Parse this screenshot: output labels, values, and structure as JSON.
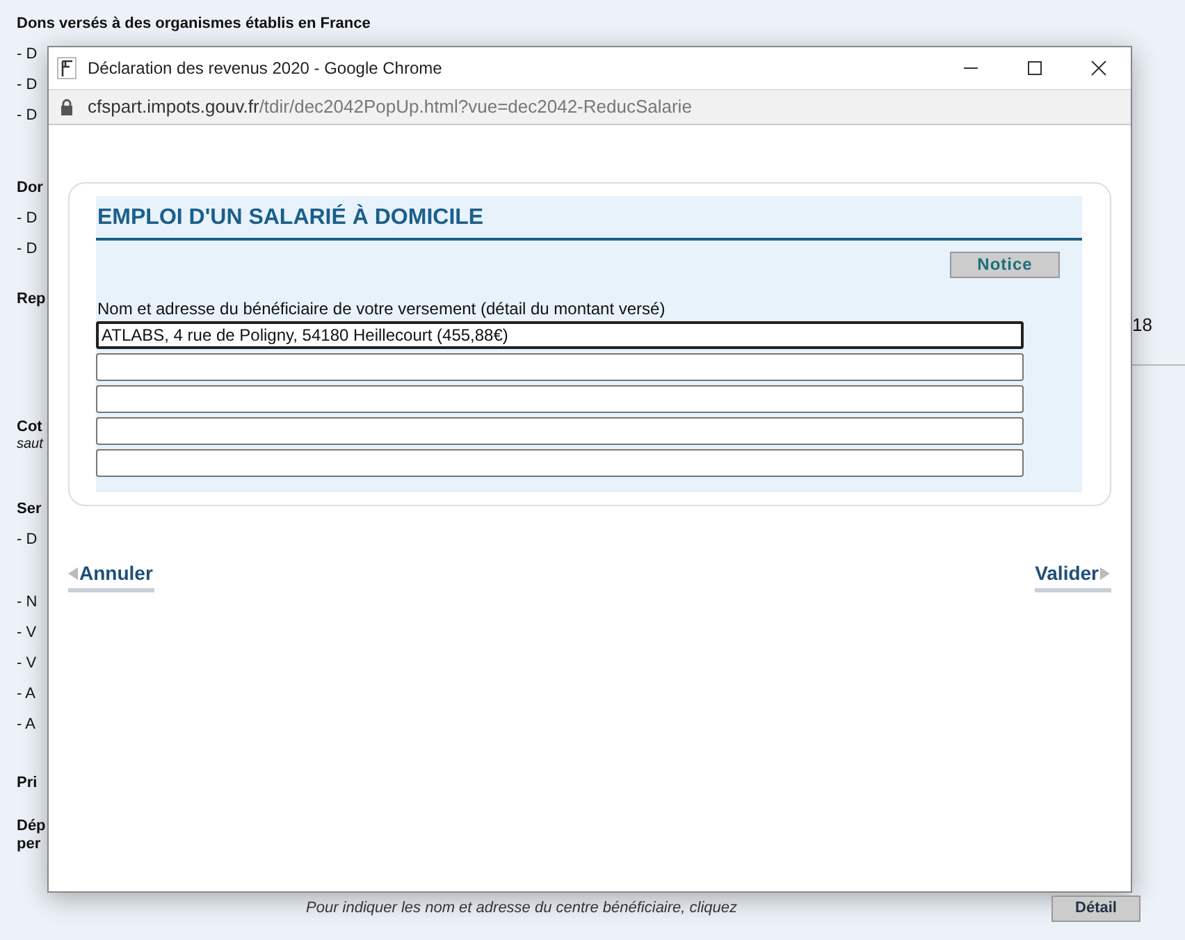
{
  "background_page": {
    "sections": [
      {
        "heading": "Dons versés à des organismes établis en France",
        "lines": [
          "- D",
          "- D",
          "- D"
        ]
      },
      {
        "heading": "Dor",
        "lines": [
          "- D",
          "- D"
        ]
      },
      {
        "heading": "Rep"
      },
      {
        "heading": "Cot",
        "note": "saut"
      },
      {
        "heading": "Ser",
        "lines": [
          "- D"
        ]
      },
      {
        "lines": [
          "- N",
          "- V",
          "- V",
          "- A",
          "- A"
        ]
      },
      {
        "heading": "Pri"
      },
      {
        "heading": "Dép",
        "heading_line_2": "per"
      }
    ],
    "right_value": "18",
    "bottom_note": "Pour indiquer les nom et adresse du centre bénéficiaire, cliquez",
    "bottom_button": "Détail"
  },
  "window": {
    "title": "Déclaration des revenus 2020 - Google Chrome",
    "url_host": "cfspart.impots.gouv.fr",
    "url_path": "/tdir/dec2042PopUp.html?vue=dec2042-ReducSalarie"
  },
  "form": {
    "title": "EMPLOI D'UN SALARIÉ À DOMICILE",
    "notice_button": "Notice",
    "field_label": "Nom et adresse du bénéficiaire de votre versement (détail du montant versé)",
    "fields": [
      {
        "value": "ATLABS, 4 rue de Poligny, 54180 Heillecourt (455,88€)",
        "focused": true
      },
      {
        "focused": false
      },
      {
        "focused": false
      },
      {
        "focused": false
      },
      {
        "focused": false
      }
    ]
  },
  "actions": {
    "cancel": "Annuler",
    "submit": "Valider"
  }
}
